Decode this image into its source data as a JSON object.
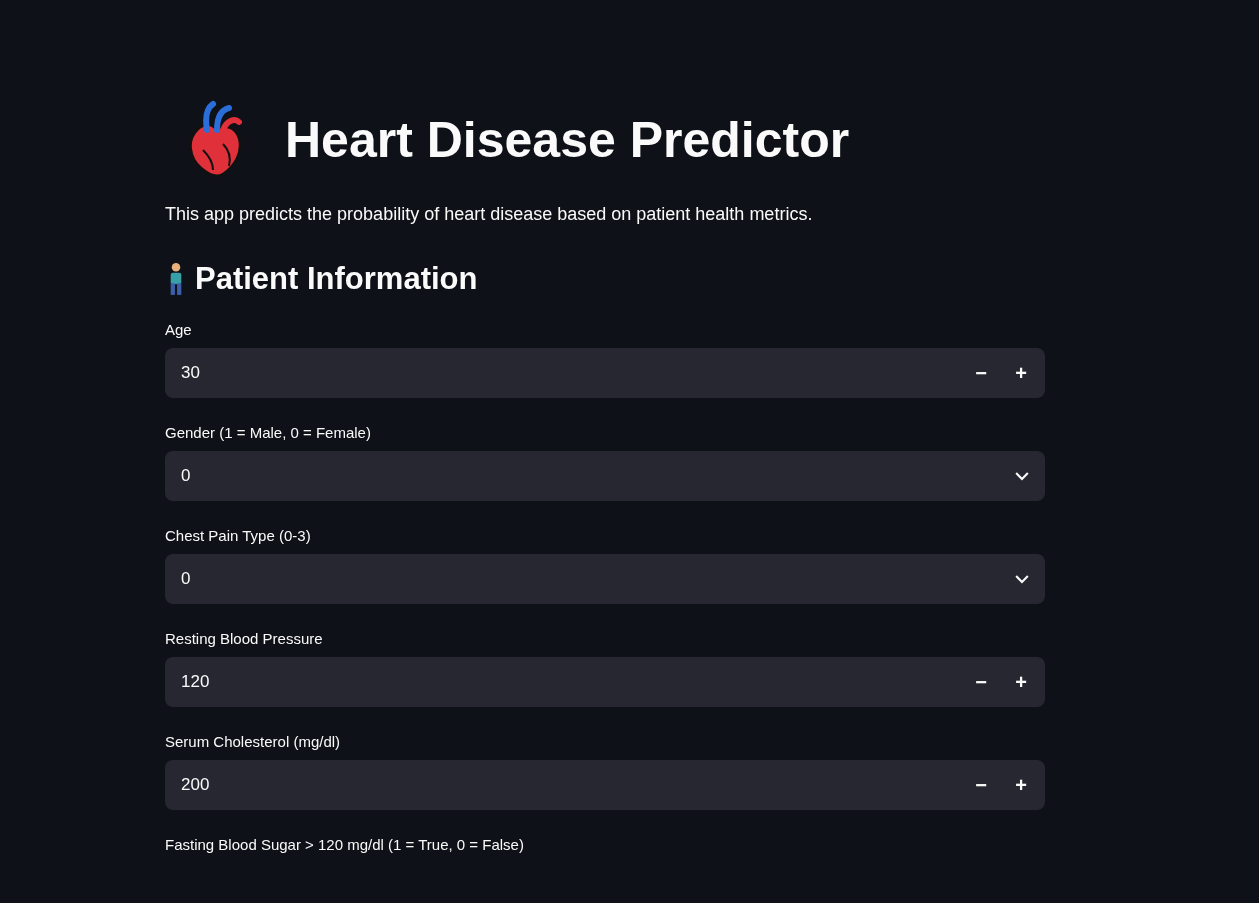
{
  "header": {
    "title": "Heart Disease Predictor",
    "description": "This app predicts the probability of heart disease based on patient health metrics."
  },
  "section": {
    "heading": "Patient Information"
  },
  "fields": [
    {
      "kind": "number",
      "label": "Age",
      "value": "30",
      "minus": "−",
      "plus": "+"
    },
    {
      "kind": "select",
      "label": "Gender (1 = Male, 0 = Female)",
      "value": "0"
    },
    {
      "kind": "select",
      "label": "Chest Pain Type (0-3)",
      "value": "0"
    },
    {
      "kind": "number",
      "label": "Resting Blood Pressure",
      "value": "120",
      "minus": "−",
      "plus": "+"
    },
    {
      "kind": "number",
      "label": "Serum Cholesterol (mg/dl)",
      "value": "200",
      "minus": "−",
      "plus": "+"
    },
    {
      "kind": "label",
      "label": "Fasting Blood Sugar > 120 mg/dl (1 = True, 0 = False)"
    }
  ]
}
